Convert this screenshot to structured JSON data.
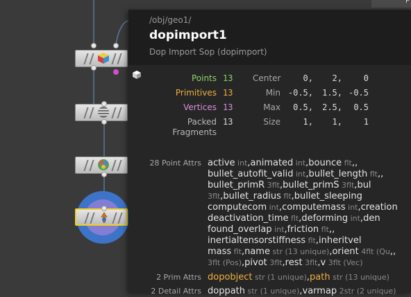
{
  "topbar": {
    "text": "P"
  },
  "panel": {
    "path": "/obj/geo1/",
    "name": "dopimport1",
    "type": "Dop Import Sop (dopimport)"
  },
  "colors": {
    "points": "#8fd26a",
    "primitives": "#f0b040",
    "vertices": "#d890d8",
    "packed": "#b8b8b8",
    "display_ring": "#3d74c8",
    "selected_outline": "#f2d020"
  },
  "stats": [
    {
      "label": "Points",
      "value": "13"
    },
    {
      "label": "Primitives",
      "value": "13"
    },
    {
      "label": "Vertices",
      "value": "13"
    },
    {
      "label": "Packed Fragments",
      "value": "13"
    }
  ],
  "bounds": [
    {
      "label": "Center",
      "values": [
        "0,",
        "2,",
        "0"
      ]
    },
    {
      "label": "Min",
      "values": [
        "-0.5,",
        "1.5,",
        "-0.5"
      ]
    },
    {
      "label": "Max",
      "values": [
        "0.5,",
        "2.5,",
        "0.5"
      ]
    },
    {
      "label": "Size",
      "values": [
        "1,",
        "1,",
        "1"
      ]
    }
  ],
  "point_attrs": {
    "label": "28 Point Attrs",
    "lines": [
      [
        [
          "active",
          "int"
        ],
        [
          "animated",
          "int"
        ],
        [
          "bounce",
          "flt"
        ]
      ],
      [
        [
          "bullet_autofit_valid",
          "int"
        ],
        [
          "bullet_length",
          "flt"
        ]
      ],
      [
        [
          "bullet_primR",
          "3flt"
        ],
        [
          "bullet_primS",
          "3flt"
        ],
        [
          "bul",
          ""
        ]
      ],
      [
        [
          "",
          "3flt"
        ],
        [
          "bullet_radius",
          "flt"
        ],
        [
          "bullet_sleeping",
          ""
        ]
      ],
      [
        [
          "computecom",
          "int"
        ],
        [
          "computemass",
          "int"
        ],
        [
          "creation",
          ""
        ]
      ],
      [
        [
          "deactivation_time",
          "flt"
        ],
        [
          "deforming",
          "int"
        ],
        [
          "den",
          ""
        ]
      ],
      [
        [
          "found_overlap",
          "int"
        ],
        [
          "friction",
          "flt"
        ]
      ],
      [
        [
          "inertialtensorstiffness",
          "flt"
        ],
        [
          "inheritvel",
          ""
        ]
      ],
      [
        [
          "mass",
          "flt"
        ],
        [
          "name",
          "str (13 unique)"
        ],
        [
          "orient",
          "4flt (Qu"
        ]
      ],
      [
        [
          "",
          "3flt (Pos)"
        ],
        [
          "pivot",
          "3flt"
        ],
        [
          "rest",
          "3flt"
        ],
        [
          "v",
          "3flt (Vec)"
        ]
      ]
    ]
  },
  "prim_attrs": {
    "label": "2 Prim Attrs",
    "items": [
      [
        "dopobject",
        "str (1 unique)"
      ],
      [
        "path",
        "str (13 unique)"
      ]
    ]
  },
  "detail_attrs": {
    "label": "2 Detail Attrs",
    "items": [
      [
        "doppath",
        "str (1 unique)"
      ],
      [
        "varmap",
        "2str (2 unique)"
      ]
    ]
  }
}
